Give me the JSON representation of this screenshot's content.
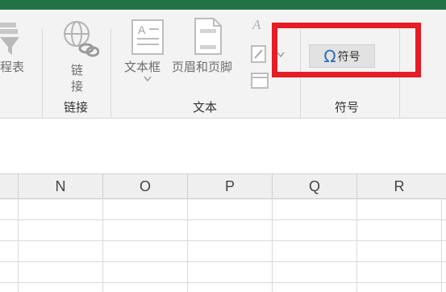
{
  "ribbon": {
    "partial_item_label": "程表",
    "link_button": {
      "label_line1": "链",
      "label_line2": "接",
      "icon": "globe-link-icon"
    },
    "textbox_button": {
      "label": "文本框",
      "icon": "textbox-icon"
    },
    "header_footer_button": {
      "label": "页眉和页脚",
      "icon": "page-icon"
    },
    "symbol_button": {
      "glyph": "Ω",
      "label": "符号",
      "icon": "omega-icon"
    },
    "groups": {
      "link": "链接",
      "text": "文本",
      "symbol": "符号"
    }
  },
  "highlight_color": "#e51d25",
  "accent_color": "#217346",
  "columns": [
    "N",
    "O",
    "P",
    "Q",
    "R"
  ]
}
